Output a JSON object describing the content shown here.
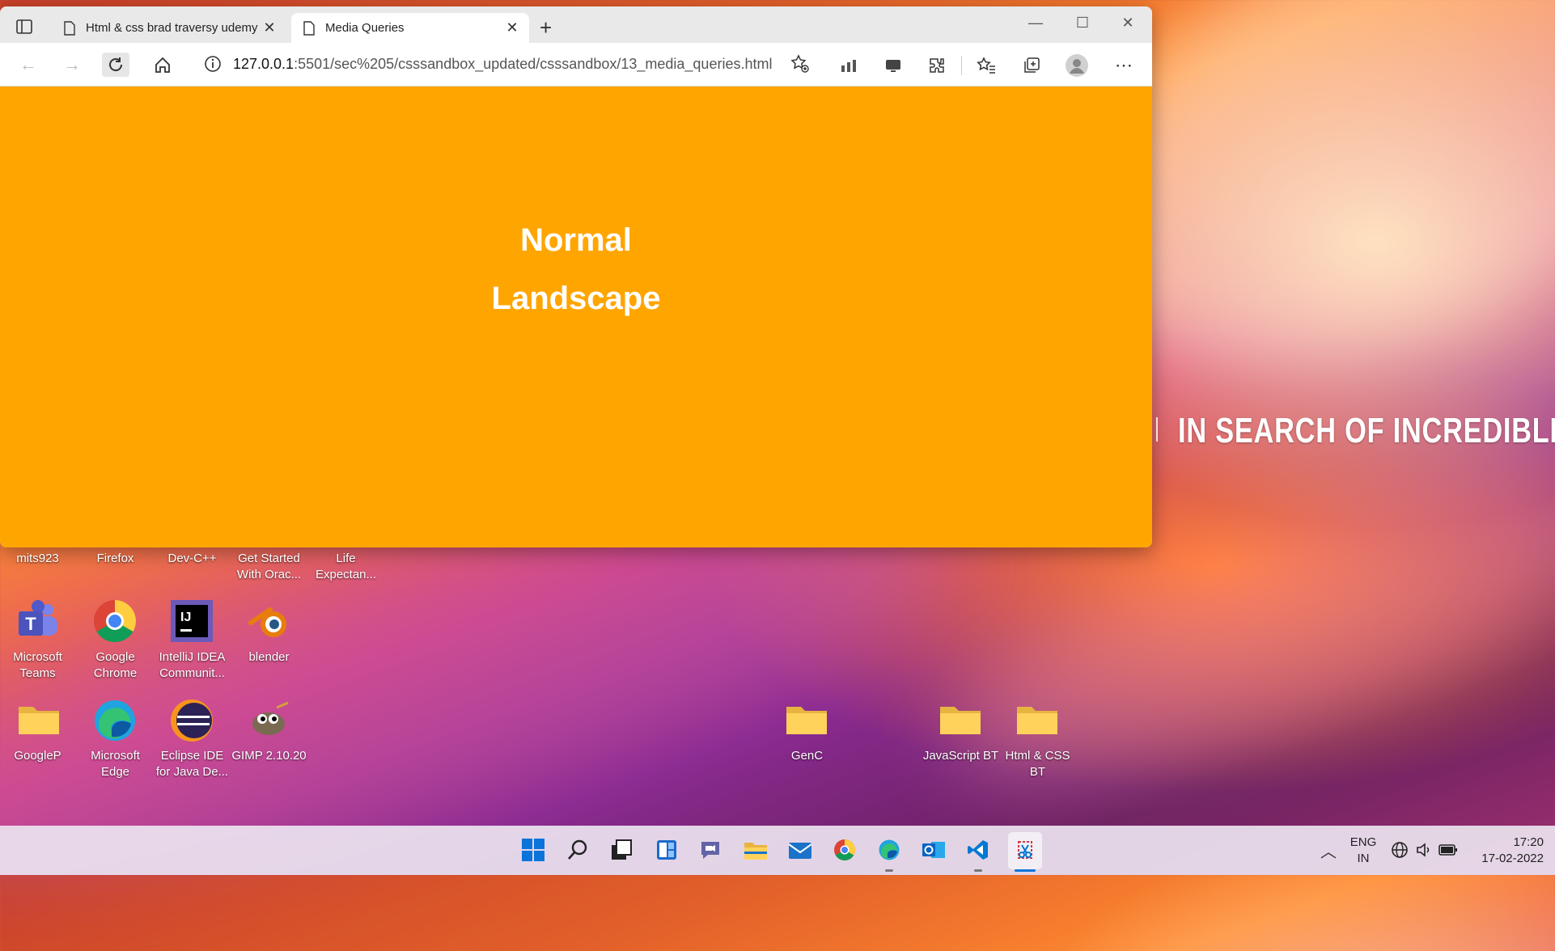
{
  "browser": {
    "tabs": [
      {
        "title": "Html & css brad traversy udemy"
      },
      {
        "title": "Media Queries"
      }
    ],
    "url_host": "127.0.0.1",
    "url_path": ":5501/sec%205/csssandbox_updated/csssandbox/13_media_queries.html"
  },
  "page": {
    "line1": "Normal",
    "line2": "Landscape",
    "background": "#ffa500"
  },
  "desktop": {
    "tagline": "IN SEARCH OF INCREDIBLE",
    "top_labels": [
      {
        "label": "mits923"
      },
      {
        "label": "Firefox"
      },
      {
        "label": "Dev-C++"
      },
      {
        "label": "Get Started With Orac..."
      },
      {
        "label": "Life Expectan..."
      }
    ],
    "row2": [
      {
        "label": "Microsoft Teams"
      },
      {
        "label": "Google Chrome"
      },
      {
        "label": "IntelliJ IDEA Communit..."
      },
      {
        "label": "blender"
      }
    ],
    "row3": [
      {
        "label": "GoogleP"
      },
      {
        "label": "Microsoft Edge"
      },
      {
        "label": "Eclipse IDE for Java De..."
      },
      {
        "label": "GIMP 2.10.20"
      }
    ],
    "folders_right": [
      {
        "label": "GenC"
      },
      {
        "label": "JavaScript BT"
      },
      {
        "label": "Html & CSS BT"
      }
    ]
  },
  "taskbar": {
    "lang_top": "ENG",
    "lang_bottom": "IN",
    "time": "17:20",
    "date": "17-02-2022"
  },
  "colors": {
    "accent_orange": "#ffa500",
    "taskbar_bg": "#ece4f0"
  }
}
